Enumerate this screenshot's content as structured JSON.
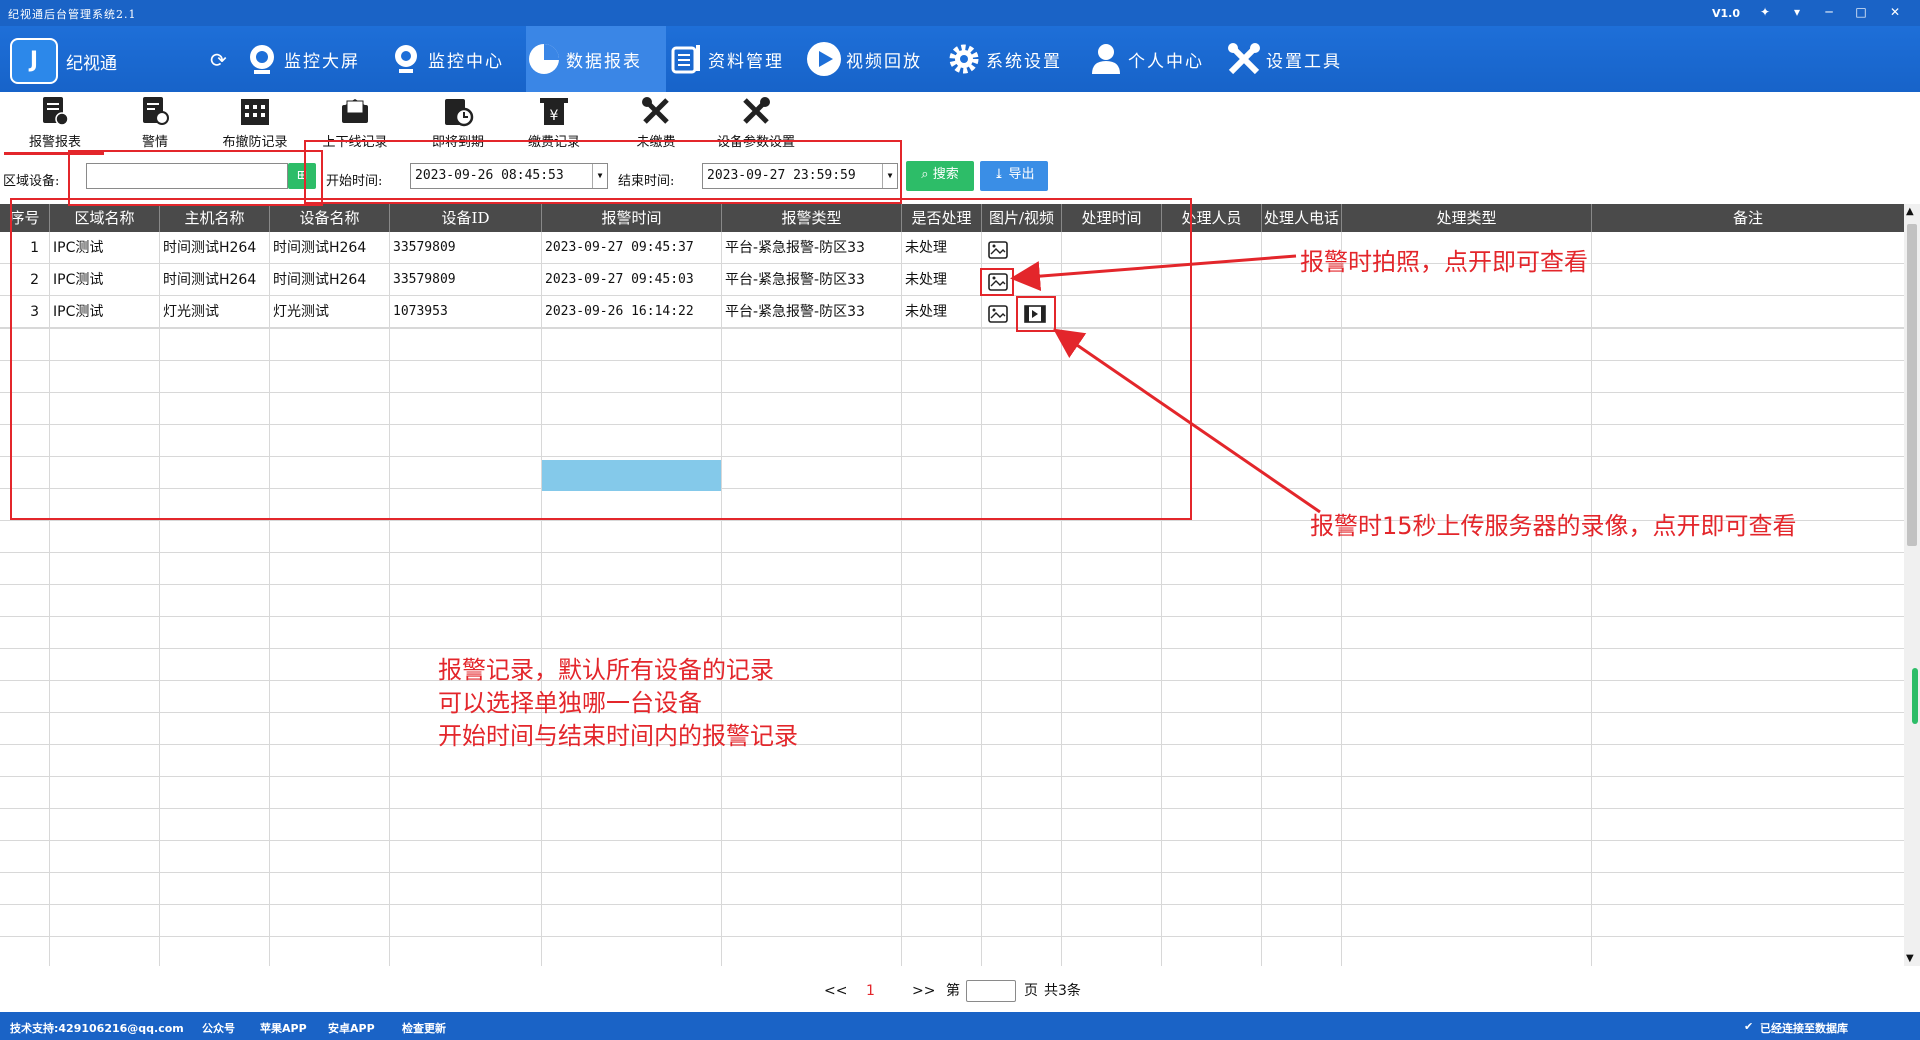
{
  "window": {
    "title": "纪视通后台管理系统2.1",
    "version": "V1.0"
  },
  "header": {
    "app_name": "纪视通",
    "nav": [
      {
        "label": "监控大屏"
      },
      {
        "label": "监控中心"
      },
      {
        "label": "数据报表"
      },
      {
        "label": "资料管理"
      },
      {
        "label": "视频回放"
      },
      {
        "label": "系统设置"
      },
      {
        "label": "个人中心"
      },
      {
        "label": "设置工具"
      }
    ]
  },
  "subnav": [
    {
      "label": "报警报表"
    },
    {
      "label": "警情"
    },
    {
      "label": "布撤防记录"
    },
    {
      "label": "上下线记录"
    },
    {
      "label": "即将到期"
    },
    {
      "label": "缴费记录"
    },
    {
      "label": "未缴费"
    },
    {
      "label": "设备参数设置"
    }
  ],
  "filters": {
    "area_label": "区域设备:",
    "area_value": "",
    "start_label": "开始时间:",
    "start_value": "2023-09-26 08:45:53",
    "end_label": "结束时间:",
    "end_value": "2023-09-27 23:59:59",
    "search_label": "搜索",
    "export_label": "导出"
  },
  "table": {
    "headers": [
      "序号",
      "区域名称",
      "主机名称",
      "设备名称",
      "设备ID",
      "报警时间",
      "报警类型",
      "是否处理",
      "图片/视频",
      "处理时间",
      "处理人员",
      "处理人电话",
      "处理类型",
      "备注"
    ],
    "rows": [
      {
        "no": "1",
        "area": "IPC测试",
        "host": "时间测试H264",
        "device": "时间测试H264",
        "id": "33579809",
        "time": "2023-09-27 09:45:37",
        "type": "平台-紧急报警-防区33",
        "handled": "未处理"
      },
      {
        "no": "2",
        "area": "IPC测试",
        "host": "时间测试H264",
        "device": "时间测试H264",
        "id": "33579809",
        "time": "2023-09-27 09:45:03",
        "type": "平台-紧急报警-防区33",
        "handled": "未处理"
      },
      {
        "no": "3",
        "area": "IPC测试",
        "host": "灯光测试",
        "device": "灯光测试",
        "id": "1073953",
        "time": "2023-09-26 16:14:22",
        "type": "平台-紧急报警-防区33",
        "handled": "未处理"
      }
    ]
  },
  "pager": {
    "prev": "<<",
    "current": "1",
    "next": ">>",
    "page_prefix": "第",
    "page_input": "",
    "page_suffix": "页",
    "total": "共3条"
  },
  "status": {
    "support": "技术支持:429106216@qq.com",
    "public": "公众号",
    "apple": "苹果APP",
    "android": "安卓APP",
    "update": "检查更新",
    "db": "已经连接至数据库"
  },
  "annotations": {
    "photo": "报警时拍照，点开即可查看",
    "video": "报警时15秒上传服务器的录像，点开即可查看",
    "note1": "报警记录，默认所有设备的记录",
    "note2": "可以选择单独哪一台设备",
    "note3": "开始时间与结束时间内的报警记录"
  },
  "colors": {
    "primary": "#1a63c6",
    "accent_red": "#e3262b",
    "search_green": "#2dbd68",
    "export_blue": "#3a8ee6",
    "header_dark": "#4a4a4a",
    "selected_cell": "#84c9ea"
  }
}
